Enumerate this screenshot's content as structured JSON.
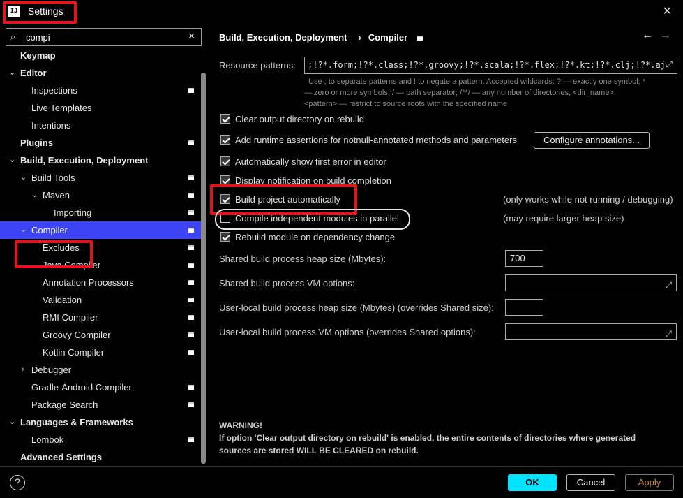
{
  "window": {
    "title": "Settings",
    "app_icon_text": "IJ",
    "close_icon": "✕"
  },
  "search": {
    "icon": "⌕",
    "value": "compi",
    "clear_icon": "✕"
  },
  "tree": [
    {
      "label": "Keymap",
      "bold": true
    },
    {
      "label": "Editor",
      "bold": true,
      "chev": "down"
    },
    {
      "label": "Inspections",
      "sq": true
    },
    {
      "label": "Live Templates"
    },
    {
      "label": "Intentions"
    },
    {
      "label": "Plugins",
      "bold": true,
      "sq": true
    },
    {
      "label": "Build, Execution, Deployment",
      "bold": true,
      "chev": "down"
    },
    {
      "label": "Build Tools",
      "chev": "down",
      "sq": true
    },
    {
      "label": "Maven",
      "chev": "down",
      "sq": true
    },
    {
      "label": "Importing",
      "sq": true
    },
    {
      "label": "Compiler",
      "chev": "down",
      "sq": true,
      "selected": true
    },
    {
      "label": "Excludes",
      "sq": true
    },
    {
      "label": "Java Compiler",
      "sq": true
    },
    {
      "label": "Annotation Processors",
      "sq": true
    },
    {
      "label": "Validation",
      "sq": true
    },
    {
      "label": "RMI Compiler",
      "sq": true
    },
    {
      "label": "Groovy Compiler",
      "sq": true
    },
    {
      "label": "Kotlin Compiler",
      "sq": true
    },
    {
      "label": "Debugger",
      "chev": "right"
    },
    {
      "label": "Gradle-Android Compiler",
      "sq": true
    },
    {
      "label": "Package Search",
      "sq": true
    },
    {
      "label": "Languages & Frameworks",
      "bold": true,
      "chev": "down"
    },
    {
      "label": "Lombok",
      "sq": true
    },
    {
      "label": "Advanced Settings",
      "bold": true
    }
  ],
  "breadcrumb": {
    "parent": "Build, Execution, Deployment",
    "separator": "›",
    "current": "Compiler",
    "back_icon": "←",
    "forward_icon": "→"
  },
  "resource_patterns": {
    "label": "Resource patterns:",
    "value": ";!?*.form;!?*.class;!?*.groovy;!?*.scala;!?*.flex;!?*.kt;!?*.clj;!?*.aj",
    "expand_icon": "⤢",
    "hint_line1": "Use ; to separate patterns and ! to negate a pattern. Accepted wildcards: ? — exactly one symbol; *",
    "hint_line2": "— zero or more symbols; / — path separator; /**/ — any number of directories; <dir_name>:",
    "hint_line3": "<pattern> — restrict to source roots with the specified name"
  },
  "options": [
    {
      "label": "Clear output directory on rebuild",
      "checked": true
    },
    {
      "label": "Add runtime assertions for notnull-annotated methods and parameters",
      "checked": true
    },
    {
      "label": "Automatically show first error in editor",
      "checked": true
    },
    {
      "label": "Display notification on build completion",
      "checked": true
    },
    {
      "label": "Build project automatically",
      "checked": true
    },
    {
      "label": "Compile independent modules in parallel",
      "checked": false
    },
    {
      "label": "Rebuild module on dependency change",
      "checked": true
    }
  ],
  "configure_annotations_label": "Configure annotations...",
  "notes": {
    "build_auto": "(only works while not running / debugging)",
    "parallel": "(may require larger heap size)"
  },
  "fields": {
    "heap_label": "Shared build process heap size (Mbytes):",
    "heap_value": "700",
    "vm_label": "Shared build process VM options:",
    "vm_value": "",
    "user_heap_label": "User-local build process heap size (Mbytes) (overrides Shared size):",
    "user_heap_value": "",
    "user_vm_label": "User-local build process VM options (overrides Shared options):",
    "user_vm_value": ""
  },
  "warning": {
    "title": "WARNING!",
    "line1": "If option 'Clear output directory on rebuild' is enabled, the entire contents of directories where generated",
    "line2": "sources are stored WILL BE CLEARED on rebuild."
  },
  "footer": {
    "help": "?",
    "ok": "OK",
    "cancel": "Cancel",
    "apply": "Apply"
  },
  "colors": {
    "selection": "#3d44f5",
    "ok_button": "#00e3ff",
    "highlight_red": "#e8121b",
    "apply_text": "#c48a28"
  }
}
